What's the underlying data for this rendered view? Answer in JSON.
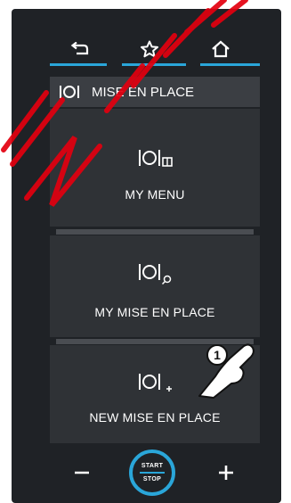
{
  "header": {
    "title": "MISE EN PLACE"
  },
  "tiles": [
    {
      "label": "MY MENU"
    },
    {
      "label": "MY MISE EN PLACE"
    },
    {
      "label": "NEW MISE EN PLACE"
    }
  ],
  "start_stop": {
    "start": "START",
    "stop": "STOP"
  },
  "callout": {
    "number": "1"
  },
  "colors": {
    "accent": "#2aa6d9",
    "panel": "#1f2226",
    "tile": "#2f3236",
    "watermark": "#e3000f"
  }
}
